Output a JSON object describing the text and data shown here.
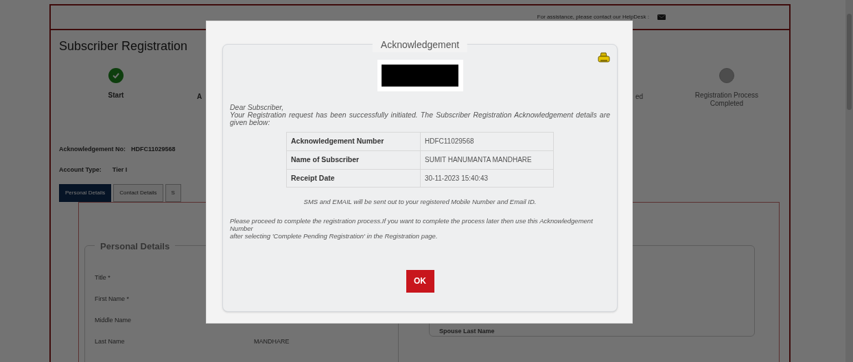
{
  "page": {
    "helpdesk_text": "For assistance, please contact our HelpDesk :",
    "title": "Subscriber Registration",
    "steps": [
      {
        "label": "Start",
        "done": true
      },
      {
        "label": "Registration Process Completed",
        "done": false
      }
    ],
    "cut_step_labels": [
      "A",
      "ed"
    ],
    "ack_label": "Acknowledgement No:",
    "ack_value": "HDFC11029568",
    "account_label": "Account Type:",
    "account_value": "Tier I",
    "tabs": [
      {
        "label": "Personal Details",
        "selected": true
      },
      {
        "label": "Contact Details",
        "selected": false
      },
      {
        "label": "S",
        "selected": false
      }
    ],
    "personal_details": {
      "legend": "Personal Details",
      "fields": [
        {
          "label": "Title *"
        },
        {
          "label": "First Name *"
        },
        {
          "label": "Middle Name"
        },
        {
          "label": "Last Name",
          "value": "MANDHARE"
        }
      ]
    },
    "spouse_fields": [
      {
        "label": "Spouse Last Name"
      }
    ]
  },
  "dialog": {
    "legend": "Acknowledgement",
    "greeting": "Dear Subscriber,",
    "message": "Your Registration request has been successfully initiated. The Subscriber Registration Acknowledgement details are given below:",
    "details": [
      {
        "label": "Acknowledgement Number",
        "value": "HDFC11029568"
      },
      {
        "label": "Name of Subscriber",
        "value": "SUMIT HANUMANTA MANDHARE"
      },
      {
        "label": "Receipt Date",
        "value": "30-11-2023 15:40:43"
      }
    ],
    "notice": "SMS and EMAIL will be sent out to your registered Mobile Number and Email ID.",
    "instructions": [
      "Please proceed to complete the registration process.If you want to complete the process later then use this Acknowledgement Number",
      "after selecting 'Complete Pending Registration' in the Registration page."
    ],
    "ok": "OK"
  }
}
